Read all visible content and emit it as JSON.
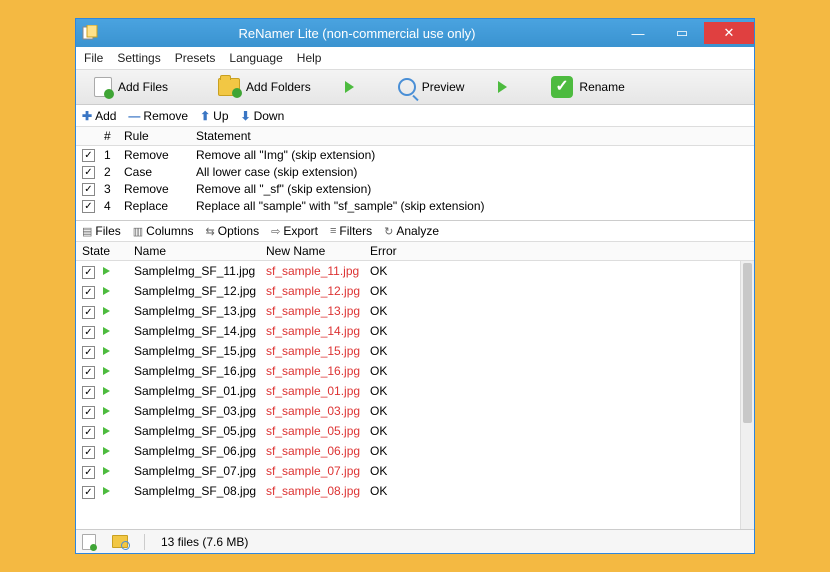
{
  "window": {
    "title": "ReNamer Lite (non-commercial use only)"
  },
  "menu": [
    "File",
    "Settings",
    "Presets",
    "Language",
    "Help"
  ],
  "toolbar": {
    "add_files": "Add Files",
    "add_folders": "Add Folders",
    "preview": "Preview",
    "rename": "Rename"
  },
  "rules_toolbar": {
    "add": "Add",
    "remove": "Remove",
    "up": "Up",
    "down": "Down"
  },
  "rules_header": {
    "num": "#",
    "rule": "Rule",
    "statement": "Statement"
  },
  "rules": [
    {
      "checked": true,
      "num": "1",
      "rule": "Remove",
      "statement": "Remove all \"Img\" (skip extension)"
    },
    {
      "checked": true,
      "num": "2",
      "rule": "Case",
      "statement": "All lower case (skip extension)"
    },
    {
      "checked": true,
      "num": "3",
      "rule": "Remove",
      "statement": "Remove all \"_sf\" (skip extension)"
    },
    {
      "checked": true,
      "num": "4",
      "rule": "Replace",
      "statement": "Replace all \"sample\" with \"sf_sample\" (skip extension)"
    }
  ],
  "files_toolbar": {
    "files": "Files",
    "columns": "Columns",
    "options": "Options",
    "export": "Export",
    "filters": "Filters",
    "analyze": "Analyze"
  },
  "files_header": {
    "state": "State",
    "name": "Name",
    "new_name": "New Name",
    "error": "Error"
  },
  "files": [
    {
      "checked": true,
      "name": "SampleImg_SF_11.jpg",
      "new_name": "sf_sample_11.jpg",
      "error": "OK"
    },
    {
      "checked": true,
      "name": "SampleImg_SF_12.jpg",
      "new_name": "sf_sample_12.jpg",
      "error": "OK"
    },
    {
      "checked": true,
      "name": "SampleImg_SF_13.jpg",
      "new_name": "sf_sample_13.jpg",
      "error": "OK"
    },
    {
      "checked": true,
      "name": "SampleImg_SF_14.jpg",
      "new_name": "sf_sample_14.jpg",
      "error": "OK"
    },
    {
      "checked": true,
      "name": "SampleImg_SF_15.jpg",
      "new_name": "sf_sample_15.jpg",
      "error": "OK"
    },
    {
      "checked": true,
      "name": "SampleImg_SF_16.jpg",
      "new_name": "sf_sample_16.jpg",
      "error": "OK"
    },
    {
      "checked": true,
      "name": "SampleImg_SF_01.jpg",
      "new_name": "sf_sample_01.jpg",
      "error": "OK"
    },
    {
      "checked": true,
      "name": "SampleImg_SF_03.jpg",
      "new_name": "sf_sample_03.jpg",
      "error": "OK"
    },
    {
      "checked": true,
      "name": "SampleImg_SF_05.jpg",
      "new_name": "sf_sample_05.jpg",
      "error": "OK"
    },
    {
      "checked": true,
      "name": "SampleImg_SF_06.jpg",
      "new_name": "sf_sample_06.jpg",
      "error": "OK"
    },
    {
      "checked": true,
      "name": "SampleImg_SF_07.jpg",
      "new_name": "sf_sample_07.jpg",
      "error": "OK"
    },
    {
      "checked": true,
      "name": "SampleImg_SF_08.jpg",
      "new_name": "sf_sample_08.jpg",
      "error": "OK"
    }
  ],
  "statusbar": {
    "text": "13 files (7.6 MB)"
  }
}
